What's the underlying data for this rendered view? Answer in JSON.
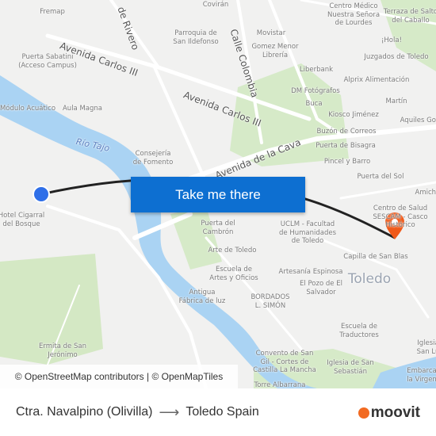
{
  "map": {
    "labels": [
      "Fremap",
      "Puerta Sabatini\n(Acceso Campus)",
      "Módulo Acuático",
      "Aula Magna",
      "Consejería\nde Fomento",
      "Parroquia de\nSan Ildefonso",
      "Movistar",
      "Gomez Menor\nLibrería",
      "Liberbank",
      "DM Fotógrafos",
      "Buca",
      "Kiosco Jiménez",
      "Buzón de Correos",
      "Puerta de Bisagra",
      "Pincel y Barro",
      "Puerta del Sol",
      "Centro Médico\nNuestra Señora\nde Lourdes",
      "Terraza de Salto\ndel Caballo",
      "¡Hola!",
      "Juzgados de Toledo",
      "Alprix Alimentación",
      "Martín",
      "Aquiles Gou",
      "Amichi",
      "Centro de Salud\nSESCAM - Casco\nHistórico",
      "Puerta del\nCambrón",
      "UCLM - Facultad\nde Humanidades\nde Toledo",
      "Arte de Toledo",
      "Capilla de San Blas",
      "Escuela de\nArtes y Oficios",
      "Artesanía Espinosa",
      "El Pozo de El\nSalvador",
      "Antigua\nFábrica de luz",
      "BORDADOS\nL. SIMÓN",
      "Escuela de\nTraductores",
      "Convento de San\nGil - Cortes de\nCastilla La Mancha",
      "Iglesia de San\nSebastián",
      "Embarca\nla Virgen",
      "Torre Albarrana",
      "Hotel Cigarral\ndel Bosque",
      "Ermita de San\nJerónimo",
      "Iglesia\nSan Lu",
      "Covirán"
    ],
    "streets": [
      "Avenida Carlos III",
      "Avenida Carlos III",
      "de Rivero",
      "Calle Colombia",
      "Avenida de la Cava"
    ],
    "river": "Río Tajo",
    "city": "Toledo",
    "colors": {
      "route": "#222222",
      "origin": "#2f6fe8",
      "destination": "#f05a1a",
      "water": "#aad3f3",
      "park": "#cfe6bd"
    }
  },
  "cta": {
    "label": "Take me there"
  },
  "attribution": "© OpenStreetMap contributors | © OpenMapTiles",
  "footer": {
    "from": "Ctra. Navalpino (Olivilla)",
    "arrow": "⟶",
    "to": "Toledo Spain",
    "brand": "moovit"
  }
}
